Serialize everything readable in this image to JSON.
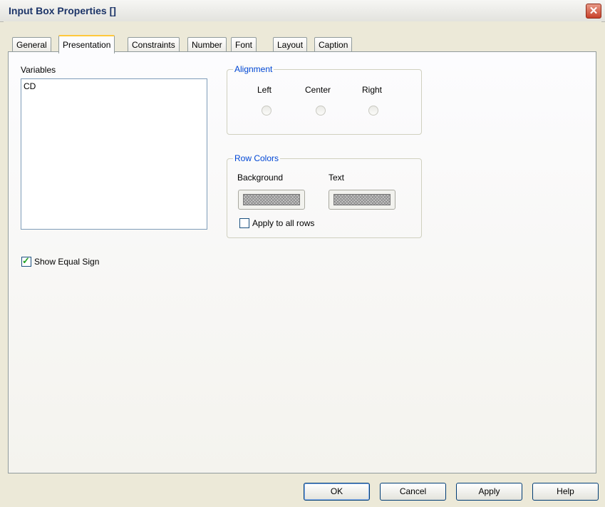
{
  "window": {
    "title": "Input Box Properties []"
  },
  "tabs": [
    {
      "label": "General"
    },
    {
      "label": "Presentation"
    },
    {
      "label": "Constraints"
    },
    {
      "label": "Number"
    },
    {
      "label": "Font"
    },
    {
      "label": "Layout"
    },
    {
      "label": "Caption"
    }
  ],
  "active_tab": "Presentation",
  "variables": {
    "label": "Variables",
    "items": [
      "CD"
    ]
  },
  "alignment": {
    "legend": "Alignment",
    "options": [
      "Left",
      "Center",
      "Right"
    ],
    "selected": null
  },
  "row_colors": {
    "legend": "Row Colors",
    "background_label": "Background",
    "text_label": "Text",
    "apply_all_label": "Apply to all rows",
    "apply_all_checked": false
  },
  "show_equal_sign": {
    "label": "Show Equal Sign",
    "checked": true
  },
  "buttons": {
    "ok": "OK",
    "cancel": "Cancel",
    "apply": "Apply",
    "help": "Help"
  },
  "colors": {
    "title_text": "#1c3468",
    "group_legend": "#0046d5",
    "close_button": "#c8412a",
    "active_tab_accent": "#ffc83c"
  },
  "icons": {
    "close": "close-icon",
    "check": "checkmark-icon"
  }
}
